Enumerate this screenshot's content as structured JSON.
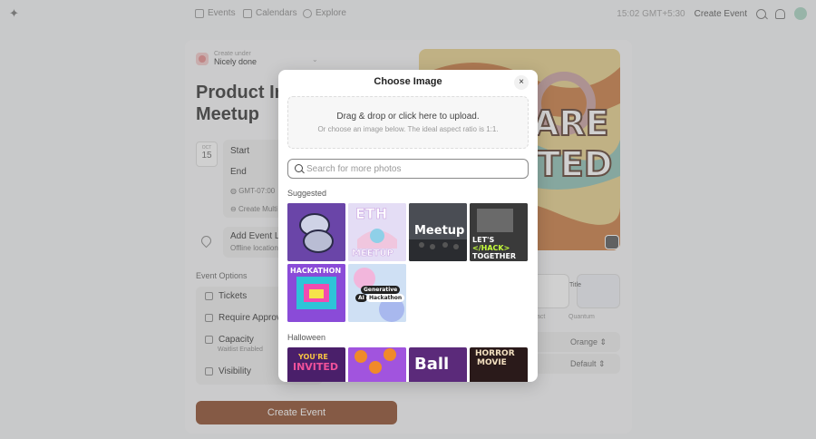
{
  "nav": {
    "events": "Events",
    "calendars": "Calendars",
    "explore": "Explore",
    "time": "15:02 GMT+5:30",
    "create_event": "Create Event"
  },
  "form": {
    "create_under_label": "Create under",
    "create_under_value": "Nicely done",
    "title_line1": "Product Ins",
    "title_line2": "Meetup",
    "date_month": "OCT",
    "date_day": "15",
    "start_label": "Start",
    "end_label": "End",
    "timezone": "GMT-07:00",
    "create_multi": "Create Multi",
    "location_label": "Add Event L",
    "location_sub": "Offline location",
    "options_heading": "Event Options",
    "options": [
      {
        "label": "Tickets"
      },
      {
        "label": "Require Approv"
      },
      {
        "label": "Capacity"
      },
      {
        "label": "Visibility"
      }
    ],
    "capacity_sub": "Waitlist Enabled",
    "create_button": "Create Event"
  },
  "theme": {
    "theme_title": "Title",
    "theme_label_1": "act",
    "theme_label_2": "Quantum",
    "color_value": "Orange",
    "font_value": "Default"
  },
  "modal": {
    "title": "Choose Image",
    "close": "×",
    "dropzone_main": "Drag & drop or click here to upload.",
    "dropzone_sub": "Or choose an image below. The ideal aspect ratio is 1:1.",
    "search_placeholder": "Search for more photos",
    "section_suggested": "Suggested",
    "section_halloween": "Halloween",
    "thumb_texts": {
      "ethmeetup_top": "ETH",
      "ethmeetup_bottom": "MEETUP",
      "meetup": "Meetup",
      "hack_line1": "LET'S",
      "hack_line2": "</HACK>",
      "hack_line3": "TOGETHER",
      "hackathon": "HACKATHON",
      "gen1": "Generative",
      "gen2": "AI",
      "gen3": "Hackathon",
      "invited1": "YOU'RE",
      "invited2": "INVITED",
      "ball": "Ball",
      "horror1": "HORROR",
      "horror2": "MOVIE"
    }
  },
  "cover": {
    "text1": "ARE",
    "text2": "TED"
  }
}
